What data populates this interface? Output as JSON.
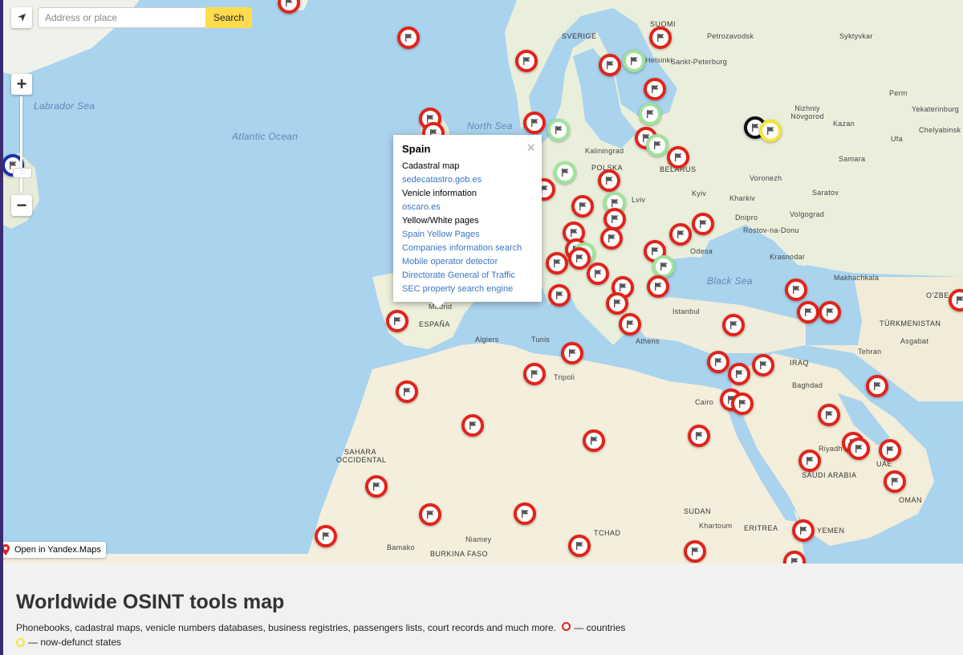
{
  "search": {
    "placeholder": "Address or place",
    "button_label": "Search"
  },
  "map": {
    "zoom_handle_glyph": ":::",
    "open_link_label": "Open in Yandex.Maps",
    "water_labels": [
      "Labrador Sea",
      "Atlantic Ocean",
      "North Sea",
      "Black Sea"
    ],
    "country_labels": [
      "SVERIGE",
      "SUOMI",
      "POLSKA",
      "BELARUS",
      "ESPAÑA",
      "TÜRKMENISTAN",
      "IRAQ",
      "SAUDI ARABIA",
      "YEMEN",
      "SUDAN",
      "SAHARA OCCIDENTAL",
      "BURKINA FASO",
      "TCHAD",
      "ERITREA",
      "OMAN",
      "UAE",
      "O'ZBE"
    ],
    "city_labels": [
      "Petrozavodsk",
      "Syktyvkar",
      "Helsinki",
      "Sankt-Peterburg",
      "Perm",
      "Yekaterinburg",
      "Nizhniy Novgorod",
      "Kazan",
      "Chelyabinsk",
      "Ufa",
      "Samara",
      "Kaliningrad",
      "Voronezh",
      "Saratov",
      "Kyiv",
      "Kharkiv",
      "Lviv",
      "Volgograd",
      "Dnipro",
      "Rostov-na-Donu",
      "Odesa",
      "Krasnodar",
      "Makhachkala",
      "Istanbul",
      "Athens",
      "Tehran",
      "Asgabat",
      "Algiers",
      "Tunis",
      "Tripoli",
      "Cairo",
      "Baghdad",
      "Riyadh",
      "Khartoum",
      "Niamey",
      "Bamako",
      "Madrid"
    ]
  },
  "popup": {
    "title": "Spain",
    "close_glyph": "×",
    "items": [
      {
        "text": "Cadastral map",
        "kind": "heading"
      },
      {
        "text": "sedecatastro.gob.es",
        "kind": "link"
      },
      {
        "text": "Venicle information",
        "kind": "heading"
      },
      {
        "text": "oscaro.es",
        "kind": "link"
      },
      {
        "text": "Yellow/White pages",
        "kind": "heading"
      },
      {
        "text": "Spain Yellow Pages",
        "kind": "link"
      },
      {
        "text": "Companies information search",
        "kind": "link"
      },
      {
        "text": "Mobile operator detector",
        "kind": "link"
      },
      {
        "text": "Directorate General of Traffic",
        "kind": "link"
      },
      {
        "text": "SEC property search engine",
        "kind": "link"
      }
    ]
  },
  "page": {
    "title": "Worldwide OSINT tools map",
    "description": "Phonebooks, cadastral maps, venicle numbers databases, business registries, passengers lists, court records and much more.",
    "legend_countries": "— countries",
    "legend_defunct": "— now-defunct states"
  },
  "colors": {
    "country": "#e2231a",
    "region": "#9ee39a",
    "defunct": "#f3e63a",
    "other": "#111111",
    "partial": "#1c2fb0",
    "search_button": "#ffdb4d",
    "link": "#3a76c4",
    "water": "#aad3ee"
  }
}
